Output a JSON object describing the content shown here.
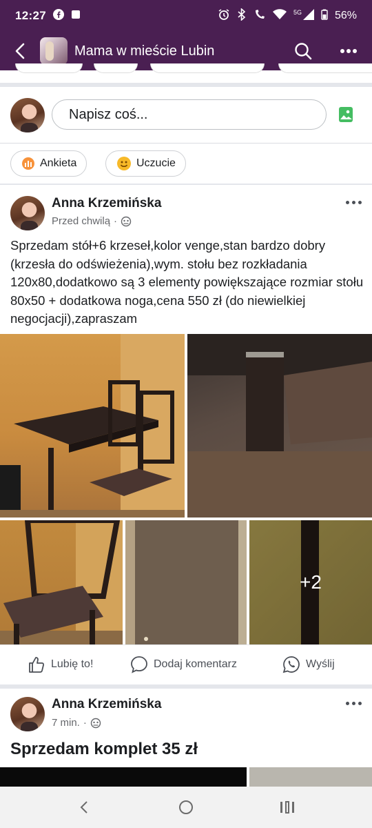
{
  "status": {
    "time": "12:27",
    "battery": "56%",
    "network": "5G"
  },
  "app": {
    "title": "Mama w mieście Lubin"
  },
  "composer": {
    "placeholder": "Napisz coś..."
  },
  "quick_actions": [
    {
      "label": "Ankieta",
      "icon": "poll-icon",
      "color": "#f7923a"
    },
    {
      "label": "Uczucie",
      "icon": "smile-icon",
      "color": "#f7b928"
    }
  ],
  "post1": {
    "author": "Anna Krzemińska",
    "time": "Przed chwilą",
    "text": "Sprzedam stół+6 krzeseł,kolor venge,stan bardzo dobry (krzesła do odświeżenia),wym. stołu bez rozkładania 120x80,dodatkowo są 3 elementy powiększające rozmiar stołu 80x50 + dodatkowa noga,cena 550 zł (do niewielkiej negocjacji),zapraszam",
    "more_photos": "+2"
  },
  "actions": {
    "like": "Lubię to!",
    "comment": "Dodaj komentarz",
    "share": "Wyślij"
  },
  "post2": {
    "author": "Anna Krzemińska",
    "time": "7 min.",
    "title": "Sprzedam komplet 35 zł"
  },
  "colors": {
    "header": "#4a1f52",
    "accent_green": "#45bd62"
  }
}
